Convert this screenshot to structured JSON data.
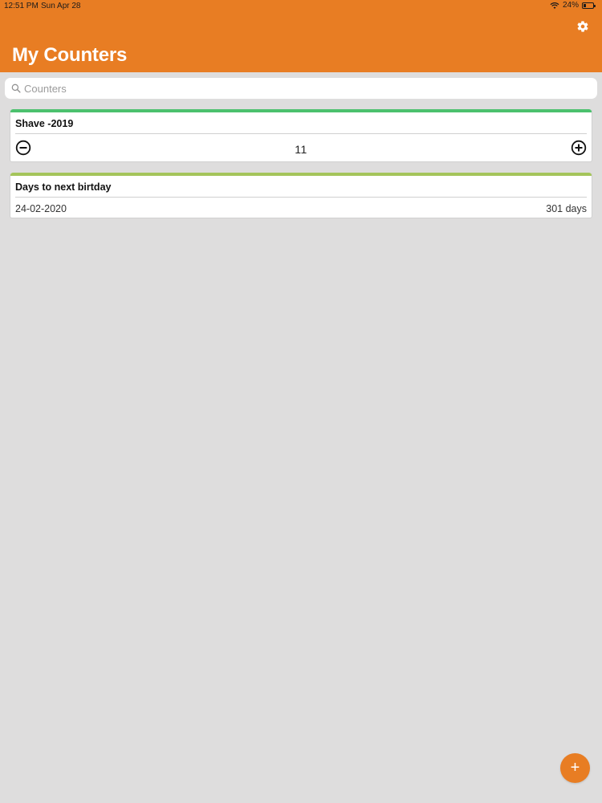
{
  "status_bar": {
    "time": "12:51 PM",
    "date": "Sun Apr 28",
    "battery_text": "24%",
    "battery_level": 0.24
  },
  "header": {
    "title": "My Counters",
    "settings_icon": "gear-icon"
  },
  "search": {
    "placeholder": "Counters",
    "value": ""
  },
  "counters": [
    {
      "title": "Shave -2019",
      "value": "11",
      "accent_color": "#4cc16e"
    }
  ],
  "date_counters": [
    {
      "title": "Days to next birtday",
      "date": "24-02-2020",
      "days": "301 days",
      "accent_color": "#a4c45a"
    }
  ],
  "fab": {
    "label": "+"
  },
  "colors": {
    "brand": "#e87d23",
    "background": "#dedddd"
  }
}
